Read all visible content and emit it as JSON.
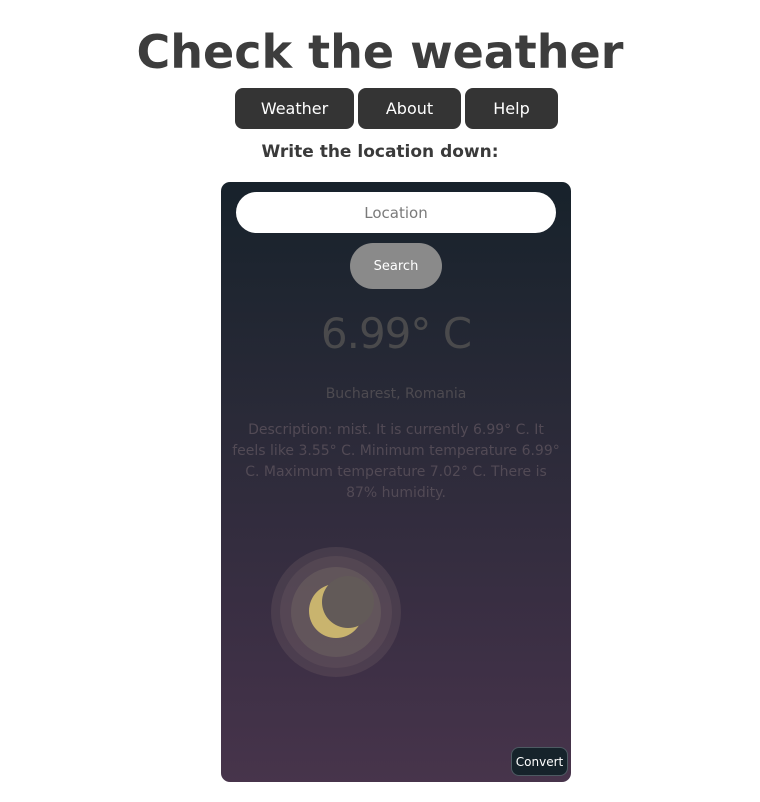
{
  "header": {
    "title": "Check the weather"
  },
  "nav": {
    "weather_label": "Weather",
    "about_label": "About",
    "help_label": "Help"
  },
  "prompt": "Write the location down:",
  "search": {
    "placeholder": "Location",
    "value": "",
    "button_label": "Search"
  },
  "result": {
    "temperature": "6.99° C",
    "location": "Bucharest, Romania",
    "description": "Description: mist. It is currently 6.99° C. It feels like 3.55° C. Minimum temperature 6.99° C. Maximum temperature 7.02° C. There is 87% humidity."
  },
  "icon": "moon-icon",
  "convert_label": "Convert",
  "colors": {
    "nav_button": "#343434",
    "card_top": "#17222b",
    "card_bottom": "#47344b",
    "moon": "#c9b46e",
    "search_button": "#8a8a8a"
  }
}
